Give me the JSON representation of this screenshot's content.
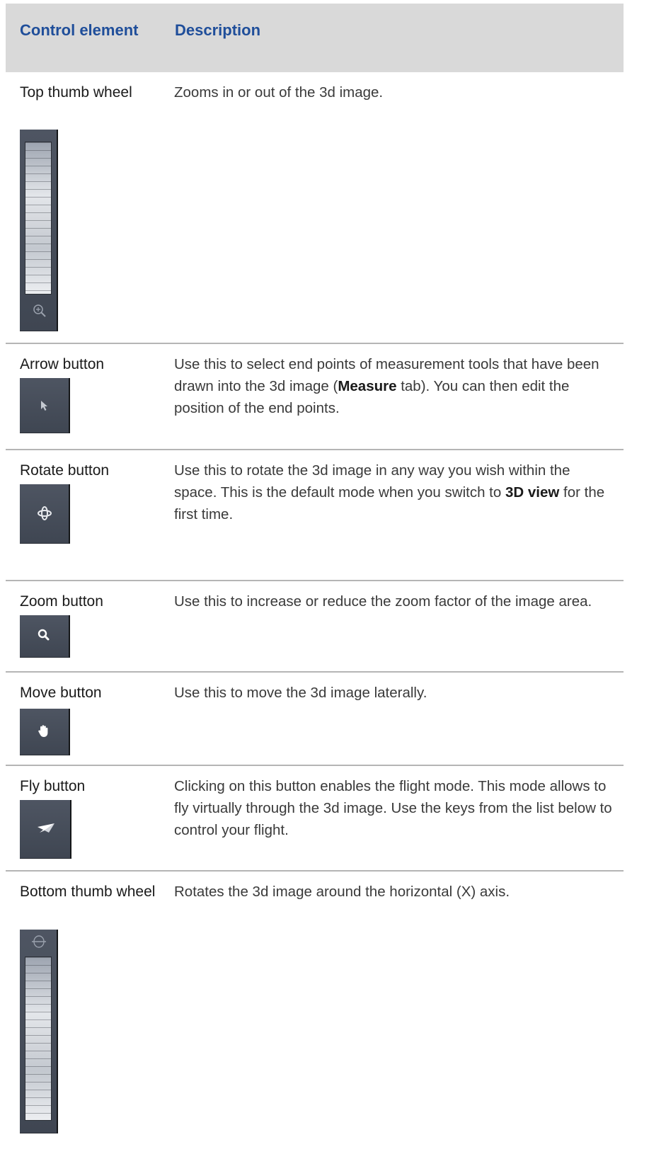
{
  "header": {
    "col1": "Control element",
    "col2": "Description"
  },
  "rows": [
    {
      "name": "Top thumb wheel",
      "desc": "Zooms in or out of the 3d image.",
      "icon": "zoom-magnifier-icon"
    },
    {
      "name": "Arrow button",
      "desc_parts": [
        "Use this to select end points of measurement tools that have been drawn into the 3d image (",
        "Measure",
        " tab). You can then edit the position of the end points."
      ],
      "icon": "arrow-cursor-icon"
    },
    {
      "name": "Rotate button",
      "desc_parts": [
        "Use this to rotate the 3d image in any way you wish within the space. This is the default mode when you switch to ",
        "3D view",
        " for the first time."
      ],
      "icon": "rotate-orbit-icon"
    },
    {
      "name": "Zoom button",
      "desc": "Use this to increase or reduce the zoom factor of the image area.",
      "icon": "magnifier-icon"
    },
    {
      "name": "Move button",
      "desc": "Use this to move the 3d image laterally.",
      "icon": "hand-icon"
    },
    {
      "name": "Fly button",
      "desc": "Clicking on this button enables the flight mode. This mode allows to fly virtually through the 3d image. Use the keys from the list below to control your flight.",
      "icon": "paper-plane-icon"
    },
    {
      "name": "Bottom thumb wheel",
      "desc": "Rotates the 3d image around the horizontal (X) axis.",
      "icon": "rotate-x-axis-icon"
    }
  ]
}
